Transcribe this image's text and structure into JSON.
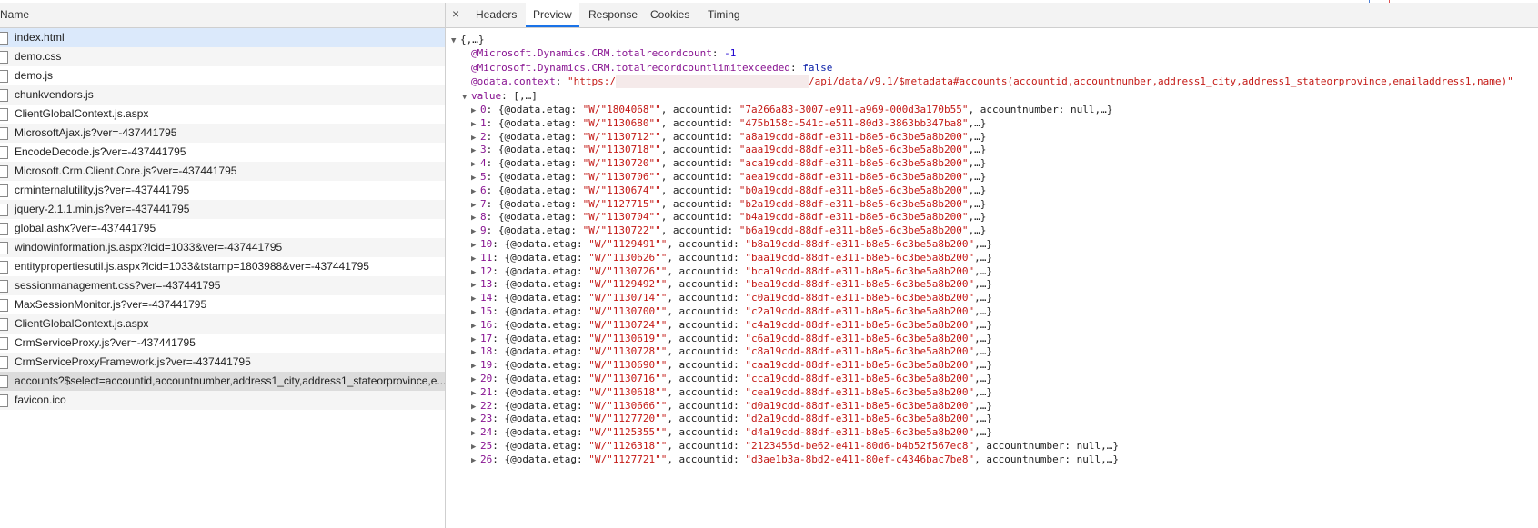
{
  "left": {
    "header": "Name",
    "requests": [
      "index.html",
      "demo.css",
      "demo.js",
      "chunkvendors.js",
      "ClientGlobalContext.js.aspx",
      "MicrosoftAjax.js?ver=-437441795",
      "EncodeDecode.js?ver=-437441795",
      "Microsoft.Crm.Client.Core.js?ver=-437441795",
      "crminternalutility.js?ver=-437441795",
      "jquery-2.1.1.min.js?ver=-437441795",
      "global.ashx?ver=-437441795",
      "windowinformation.js.aspx?lcid=1033&ver=-437441795",
      "entitypropertiesutil.js.aspx?lcid=1033&tstamp=1803988&ver=-437441795",
      "sessionmanagement.css?ver=-437441795",
      "MaxSessionMonitor.js?ver=-437441795",
      "ClientGlobalContext.js.aspx",
      "CrmServiceProxy.js?ver=-437441795",
      "CrmServiceProxyFramework.js?ver=-437441795",
      "accounts?$select=accountid,accountnumber,address1_city,address1_stateorprovince,e...",
      "favicon.ico"
    ]
  },
  "tabs": {
    "close": "×",
    "headers": "Headers",
    "preview": "Preview",
    "response": "Response",
    "cookies": "Cookies",
    "timing": "Timing"
  },
  "preview": {
    "root": "{,…}",
    "totalcount_key": "@Microsoft.Dynamics.CRM.totalrecordcount",
    "totalcount_val": "-1",
    "limit_key": "@Microsoft.Dynamics.CRM.totalrecordcountlimitexceeded",
    "limit_val": "false",
    "context_key": "@odata.context",
    "context_val_start": "\"https:/",
    "context_val_end": "/api/data/v9.1/$metadata#accounts(accountid,accountnumber,address1_city,address1_stateorprovince,emailaddress1,name)\"",
    "value_key": "value",
    "value_val": "[,…]",
    "items": [
      {
        "idx": "0",
        "etag": "\"W/\"1804068\"\"",
        "id": "\"7a266a83-3007-e911-a969-000d3a170b55\"",
        "tail": ", accountnumber: null,…}"
      },
      {
        "idx": "1",
        "etag": "\"W/\"1130680\"\"",
        "id": "\"475b158c-541c-e511-80d3-3863bb347ba8\"",
        "tail": ",…}"
      },
      {
        "idx": "2",
        "etag": "\"W/\"1130712\"\"",
        "id": "\"a8a19cdd-88df-e311-b8e5-6c3be5a8b200\"",
        "tail": ",…}"
      },
      {
        "idx": "3",
        "etag": "\"W/\"1130718\"\"",
        "id": "\"aaa19cdd-88df-e311-b8e5-6c3be5a8b200\"",
        "tail": ",…}"
      },
      {
        "idx": "4",
        "etag": "\"W/\"1130720\"\"",
        "id": "\"aca19cdd-88df-e311-b8e5-6c3be5a8b200\"",
        "tail": ",…}"
      },
      {
        "idx": "5",
        "etag": "\"W/\"1130706\"\"",
        "id": "\"aea19cdd-88df-e311-b8e5-6c3be5a8b200\"",
        "tail": ",…}"
      },
      {
        "idx": "6",
        "etag": "\"W/\"1130674\"\"",
        "id": "\"b0a19cdd-88df-e311-b8e5-6c3be5a8b200\"",
        "tail": ",…}"
      },
      {
        "idx": "7",
        "etag": "\"W/\"1127715\"\"",
        "id": "\"b2a19cdd-88df-e311-b8e5-6c3be5a8b200\"",
        "tail": ",…}"
      },
      {
        "idx": "8",
        "etag": "\"W/\"1130704\"\"",
        "id": "\"b4a19cdd-88df-e311-b8e5-6c3be5a8b200\"",
        "tail": ",…}"
      },
      {
        "idx": "9",
        "etag": "\"W/\"1130722\"\"",
        "id": "\"b6a19cdd-88df-e311-b8e5-6c3be5a8b200\"",
        "tail": ",…}"
      },
      {
        "idx": "10",
        "etag": "\"W/\"1129491\"\"",
        "id": "\"b8a19cdd-88df-e311-b8e5-6c3be5a8b200\"",
        "tail": ",…}"
      },
      {
        "idx": "11",
        "etag": "\"W/\"1130626\"\"",
        "id": "\"baa19cdd-88df-e311-b8e5-6c3be5a8b200\"",
        "tail": ",…}"
      },
      {
        "idx": "12",
        "etag": "\"W/\"1130726\"\"",
        "id": "\"bca19cdd-88df-e311-b8e5-6c3be5a8b200\"",
        "tail": ",…}"
      },
      {
        "idx": "13",
        "etag": "\"W/\"1129492\"\"",
        "id": "\"bea19cdd-88df-e311-b8e5-6c3be5a8b200\"",
        "tail": ",…}"
      },
      {
        "idx": "14",
        "etag": "\"W/\"1130714\"\"",
        "id": "\"c0a19cdd-88df-e311-b8e5-6c3be5a8b200\"",
        "tail": ",…}"
      },
      {
        "idx": "15",
        "etag": "\"W/\"1130700\"\"",
        "id": "\"c2a19cdd-88df-e311-b8e5-6c3be5a8b200\"",
        "tail": ",…}"
      },
      {
        "idx": "16",
        "etag": "\"W/\"1130724\"\"",
        "id": "\"c4a19cdd-88df-e311-b8e5-6c3be5a8b200\"",
        "tail": ",…}"
      },
      {
        "idx": "17",
        "etag": "\"W/\"1130619\"\"",
        "id": "\"c6a19cdd-88df-e311-b8e5-6c3be5a8b200\"",
        "tail": ",…}"
      },
      {
        "idx": "18",
        "etag": "\"W/\"1130728\"\"",
        "id": "\"c8a19cdd-88df-e311-b8e5-6c3be5a8b200\"",
        "tail": ",…}"
      },
      {
        "idx": "19",
        "etag": "\"W/\"1130690\"\"",
        "id": "\"caa19cdd-88df-e311-b8e5-6c3be5a8b200\"",
        "tail": ",…}"
      },
      {
        "idx": "20",
        "etag": "\"W/\"1130716\"\"",
        "id": "\"cca19cdd-88df-e311-b8e5-6c3be5a8b200\"",
        "tail": ",…}"
      },
      {
        "idx": "21",
        "etag": "\"W/\"1130618\"\"",
        "id": "\"cea19cdd-88df-e311-b8e5-6c3be5a8b200\"",
        "tail": ",…}"
      },
      {
        "idx": "22",
        "etag": "\"W/\"1130666\"\"",
        "id": "\"d0a19cdd-88df-e311-b8e5-6c3be5a8b200\"",
        "tail": ",…}"
      },
      {
        "idx": "23",
        "etag": "\"W/\"1127720\"\"",
        "id": "\"d2a19cdd-88df-e311-b8e5-6c3be5a8b200\"",
        "tail": ",…}"
      },
      {
        "idx": "24",
        "etag": "\"W/\"1125355\"\"",
        "id": "\"d4a19cdd-88df-e311-b8e5-6c3be5a8b200\"",
        "tail": ",…}"
      },
      {
        "idx": "25",
        "etag": "\"W/\"1126318\"\"",
        "id": "\"2123455d-be62-e411-80d6-b4b52f567ec8\"",
        "tail": ", accountnumber: null,…}"
      },
      {
        "idx": "26",
        "etag": "\"W/\"1127721\"\"",
        "id": "\"d3ae1b3a-8bd2-e411-80ef-c4346bac7be8\"",
        "tail": ", accountnumber: null,…}"
      }
    ]
  }
}
